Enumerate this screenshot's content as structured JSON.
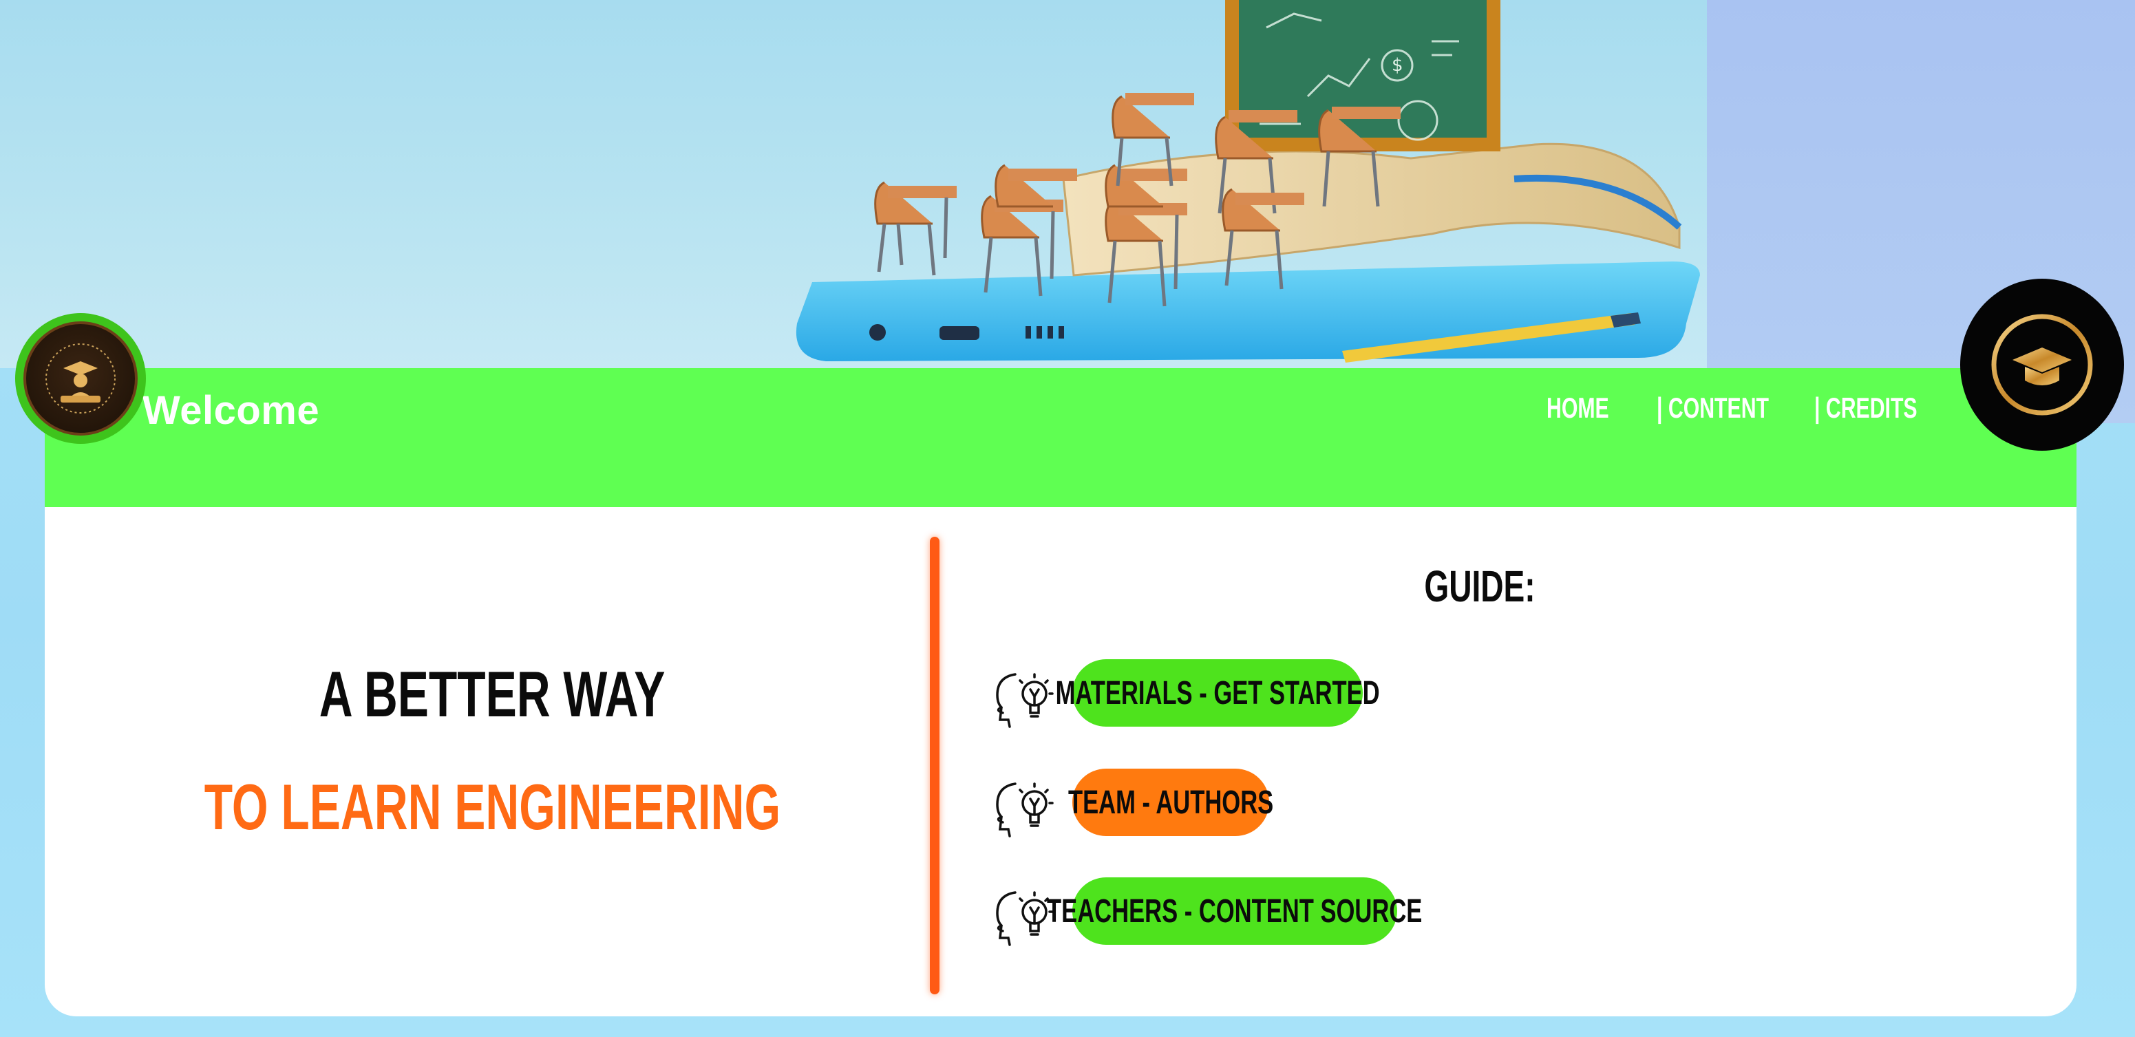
{
  "header": {
    "welcome": "Welcome",
    "nav": {
      "home": "HOME",
      "content": "| CONTENT",
      "credits": "| CREDITS"
    }
  },
  "hero": {
    "description": "Classroom desks on an open book and smartphone with chalkboard"
  },
  "main": {
    "headline_line1": "A BETTER WAY",
    "headline_line2": "TO LEARN ENGINEERING"
  },
  "guide": {
    "title": "GUIDE:",
    "items": [
      {
        "label": "MATERIALS - GET STARTED",
        "color": "#4ee31d",
        "icon": "head-lightbulb-icon"
      },
      {
        "label": "TEAM - AUTHORS",
        "color": "#ff7a0f",
        "icon": "head-lightbulb-icon"
      },
      {
        "label": "TEACHERS - CONTENT SOURCE",
        "color": "#4ee31d",
        "icon": "head-lightbulb-icon"
      }
    ]
  },
  "colors": {
    "navbar": "#5fff52",
    "accent_orange": "#ff6a14",
    "background_blue": "#a9e3f8"
  },
  "logos": {
    "left": "graduate-emblem-icon",
    "right": "graduation-cap-icon"
  }
}
